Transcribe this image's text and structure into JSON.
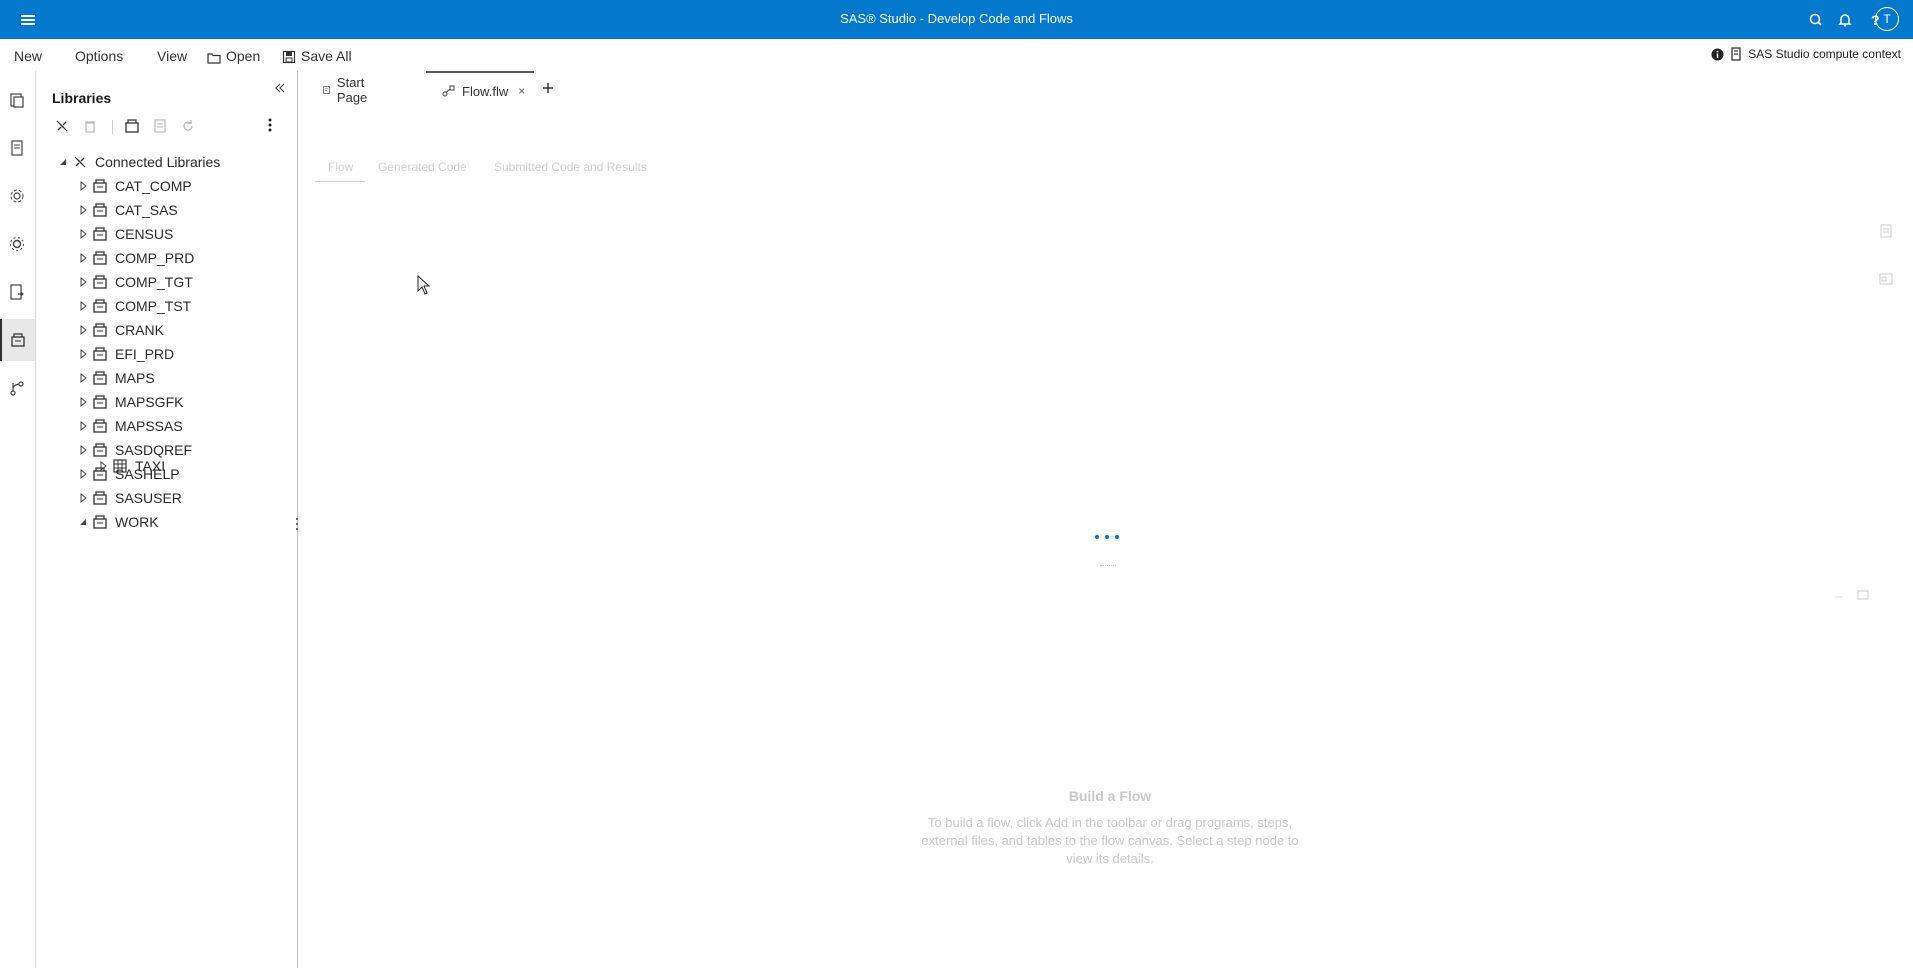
{
  "titlebar": {
    "title": "SAS® Studio - Develop Code and Flows",
    "avatar": "T",
    "icons": [
      "menu-icon",
      "search-icon",
      "bell-icon",
      "help-icon"
    ]
  },
  "menubar": {
    "new": "New",
    "options": "Options",
    "view": "View",
    "open": "Open",
    "save_all": "Save All",
    "context": "SAS Studio compute context"
  },
  "libraries": {
    "title": "Libraries",
    "root": "Connected Libraries",
    "items": [
      {
        "label": "CAT_COMP"
      },
      {
        "label": "CAT_SAS"
      },
      {
        "label": "CENSUS"
      },
      {
        "label": "COMP_PRD"
      },
      {
        "label": "COMP_TGT"
      },
      {
        "label": "COMP_TST"
      },
      {
        "label": "CRANK"
      },
      {
        "label": "EFI_PRD"
      },
      {
        "label": "MAPS"
      },
      {
        "label": "MAPSGFK"
      },
      {
        "label": "MAPSSAS"
      },
      {
        "label": "SASDQREF"
      },
      {
        "label": "SASHELP"
      },
      {
        "label": "SASUSER"
      },
      {
        "label": "WORK"
      }
    ],
    "work_child": "TAXI"
  },
  "tabs": {
    "start": "Start Page",
    "flow": "Flow.flw",
    "close": "×"
  },
  "subtabs": {
    "flow": "Flow",
    "generated": "Generated Code",
    "submitted": "Submitted Code and Results"
  },
  "empty": {
    "title": "Build a Flow",
    "desc": "To build a flow, click Add in the toolbar or drag programs, steps, external files, and tables to the flow canvas. Select a step node to view its details."
  },
  "colors": {
    "brand": "#0378cd"
  }
}
